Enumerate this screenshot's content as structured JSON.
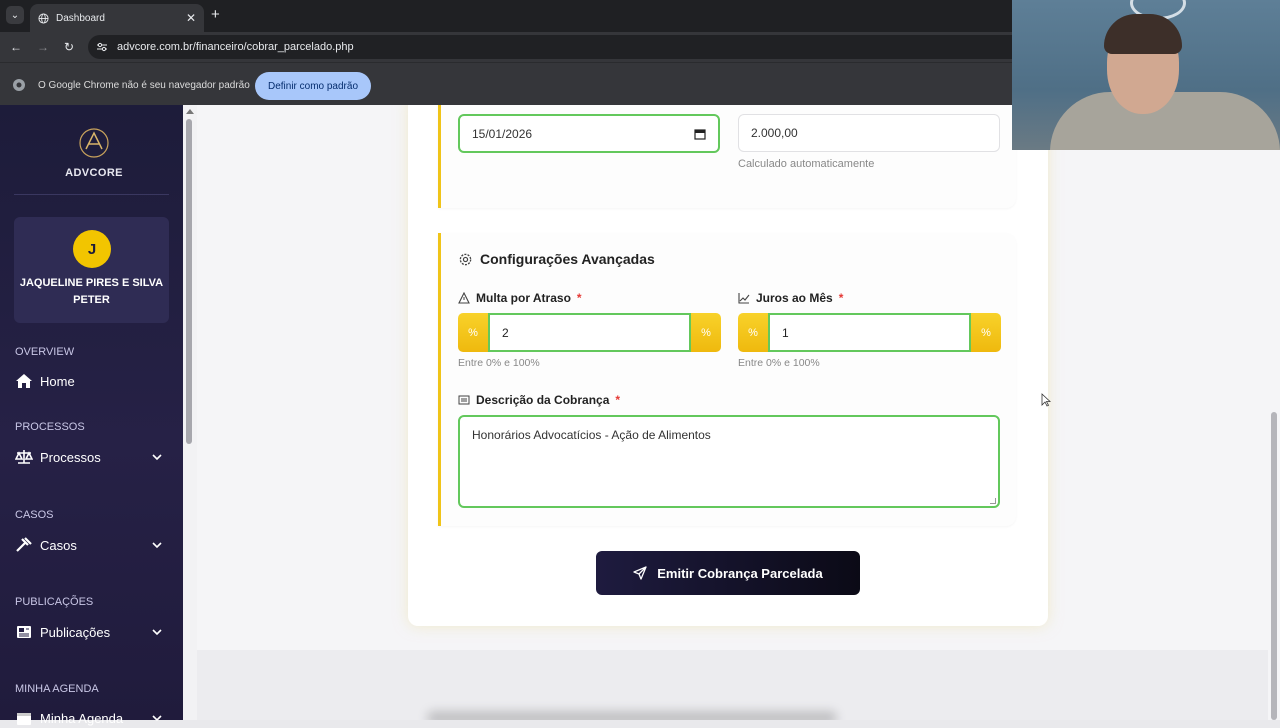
{
  "browser": {
    "tab_title": "Dashboard",
    "url": "advcore.com.br/financeiro/cobrar_parcelado.php",
    "info_message": "O Google Chrome não é seu navegador padrão",
    "info_button": "Definir como padrão"
  },
  "sidebar": {
    "logo_text": "ADVCORE",
    "user_initial": "J",
    "user_name": "JAQUELINE PIRES E SILVA PETER",
    "sections": [
      {
        "title": "OVERVIEW",
        "item": "Home",
        "icon": "home-icon",
        "expandable": false
      },
      {
        "title": "PROCESSOS",
        "item": "Processos",
        "icon": "scale-icon",
        "expandable": true
      },
      {
        "title": "CASOS",
        "item": "Casos",
        "icon": "gavel-icon",
        "expandable": true
      },
      {
        "title": "PUBLICAÇÕES",
        "item": "Publicações",
        "icon": "newspaper-icon",
        "expandable": true
      },
      {
        "title": "MINHA AGENDA",
        "item": "Minha Agenda",
        "icon": "calendar-icon",
        "expandable": true
      }
    ]
  },
  "form": {
    "due_date": "15/01/2026",
    "amount": "2.000,00",
    "amount_hint": "Calculado automaticamente",
    "advanced_title": "Configurações Avançadas",
    "fine": {
      "label": "Multa por Atraso",
      "value": "2",
      "addon": "%",
      "hint": "Entre 0% e 100%"
    },
    "interest": {
      "label": "Juros ao Mês",
      "value": "1",
      "addon": "%",
      "hint": "Entre 0% e 100%"
    },
    "description": {
      "label": "Descrição da Cobrança",
      "value": "Honorários Advocatícios - Ação de Alimentos"
    },
    "required_mark": "*",
    "submit_label": "Emitir Cobrança Parcelada"
  },
  "colors": {
    "accent_yellow": "#f0c419",
    "valid_green": "#63c85c",
    "sidebar_bg": "#1d1c3a",
    "button_dark": "#14122b"
  }
}
